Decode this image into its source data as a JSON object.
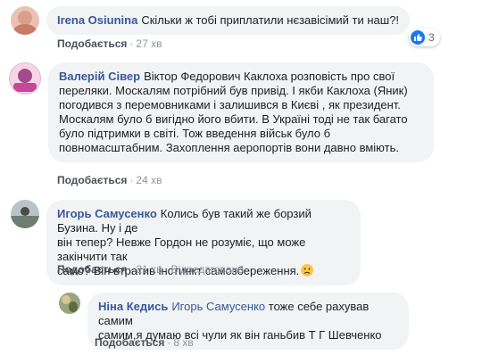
{
  "comments": [
    {
      "author": "Irena Osiunina",
      "text": "Скільки ж тобі приплатили нєзавісімий ти наш?!",
      "like_label": "Подобається",
      "time": "27 хв",
      "reaction_count": "3"
    },
    {
      "author": "Валерій Сівер",
      "line1_rest": "Віктор Федорович Каклоха розповість про свої",
      "lines": [
        "переляки. Москалям потрібний був привід. І якби Каклоха (Яник)",
        "погодився з перемовниками і залишився в Києві , як президент.",
        "Москалям було б вигідно його вбити. В Україні тоді не так багато",
        "було підтримки в світі. Тож введення військ було б",
        "повномасштабним. Захоплення аеропортів вони давно вміють."
      ],
      "like_label": "Подобається",
      "time": "24 хв"
    },
    {
      "author": "Игорь Самусенко",
      "line1_rest": "Колись був такий же борзий Бузина. Ну і де",
      "lines": [
        "він тепер? Невже Гордон не розуміє, що може закінчити так",
        "само? Він втратив інстинкт самозбереження."
      ],
      "like_label": "Подобається",
      "time": "21 хв",
      "reply_label": "Відредаговано"
    },
    {
      "author": "Ніна Кедись",
      "mention": "Игорь Самусенко",
      "line1_rest": "тоже себе рахував самим",
      "lines": [
        "самим,я думаю всі чули як він ганьбив Т Г Шевченко"
      ],
      "like_label": "Подобається",
      "time": "8 хв"
    }
  ],
  "icons": {
    "like_reaction": "thumbs-up-icon",
    "emoji": "sad-face-emoji"
  },
  "colors": {
    "author": "#385898",
    "bubble": "#f2f3f5",
    "meta": "#90949c",
    "like_blue": "#1877f2"
  }
}
